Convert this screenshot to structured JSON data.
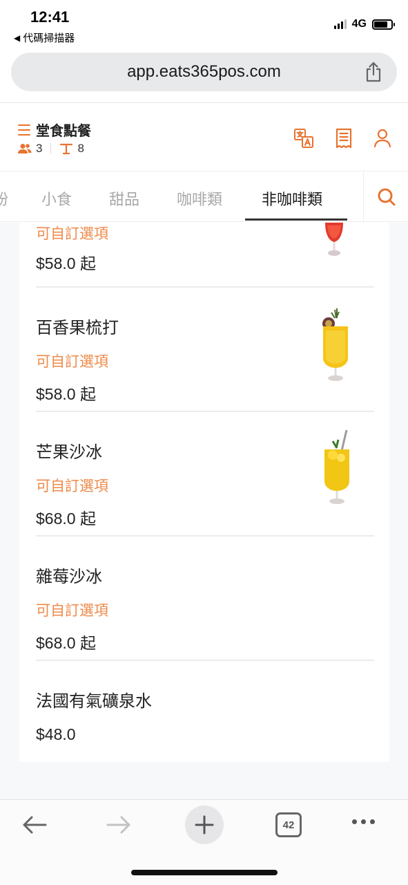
{
  "status_bar": {
    "time": "12:41",
    "back_app": "代碼掃描器",
    "network": "4G"
  },
  "browser": {
    "url": "app.eats365pos.com",
    "tab_count": "42"
  },
  "header": {
    "title": "堂食點餐",
    "guests": "3",
    "table": "8",
    "accent_color": "#e8732f"
  },
  "tabs": [
    {
      "label": "粉"
    },
    {
      "label": "小食"
    },
    {
      "label": "甜品"
    },
    {
      "label": "咖啡類"
    },
    {
      "label": "非咖啡類",
      "active": true
    }
  ],
  "items": [
    {
      "name": "",
      "customizable": "可自訂選項",
      "price": "$58.0 起",
      "image": "red-cocktail"
    },
    {
      "name": "百香果梳打",
      "customizable": "可自訂選項",
      "price": "$58.0 起",
      "image": "passionfruit-soda"
    },
    {
      "name": "芒果沙冰",
      "customizable": "可自訂選項",
      "price": "$68.0 起",
      "image": "mango-slush"
    },
    {
      "name": "雜莓沙冰",
      "customizable": "可自訂選項",
      "price": "$68.0 起"
    },
    {
      "name": "法國有氣礦泉水",
      "price": "$48.0"
    }
  ]
}
